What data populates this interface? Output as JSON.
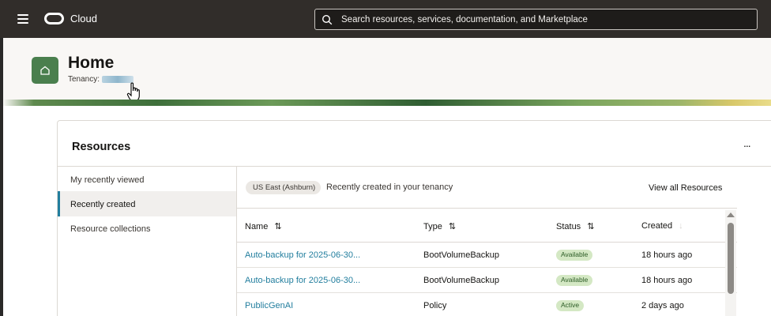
{
  "topbar": {
    "brand": "Cloud",
    "search_placeholder": "Search resources, services, documentation, and Marketplace",
    "menu_icon": "hamburger-icon",
    "logo_icon": "oracle-logo-icon"
  },
  "header": {
    "title": "Home",
    "tenancy_label": "Tenancy:",
    "icon": "home-icon"
  },
  "resources": {
    "title": "Resources",
    "more_label": "...",
    "nav": [
      {
        "label": "My recently viewed",
        "active": false
      },
      {
        "label": "Recently created",
        "active": true
      },
      {
        "label": "Resource collections",
        "active": false
      }
    ],
    "region_pill": "US East (Ashburn)",
    "subtitle": "Recently created in your tenancy",
    "view_all": "View all Resources",
    "columns": [
      "Name",
      "Type",
      "Status",
      "Created"
    ],
    "sort_icon": "⇅",
    "sort_icon_dim": "↓",
    "rows": [
      {
        "name": "Auto-backup for 2025-06-30...",
        "type": "BootVolumeBackup",
        "status": "Available",
        "created": "18 hours ago"
      },
      {
        "name": "Auto-backup for 2025-06-30...",
        "type": "BootVolumeBackup",
        "status": "Available",
        "created": "18 hours ago"
      },
      {
        "name": "PublicGenAI",
        "type": "Policy",
        "status": "Active",
        "created": "2 days ago"
      }
    ]
  },
  "colors": {
    "topbar": "#312d2a",
    "link": "#227e9e",
    "badge_bg": "#d4e8c4",
    "badge_text": "#2b5b25",
    "home_icon_bg": "#4a7f4e"
  }
}
